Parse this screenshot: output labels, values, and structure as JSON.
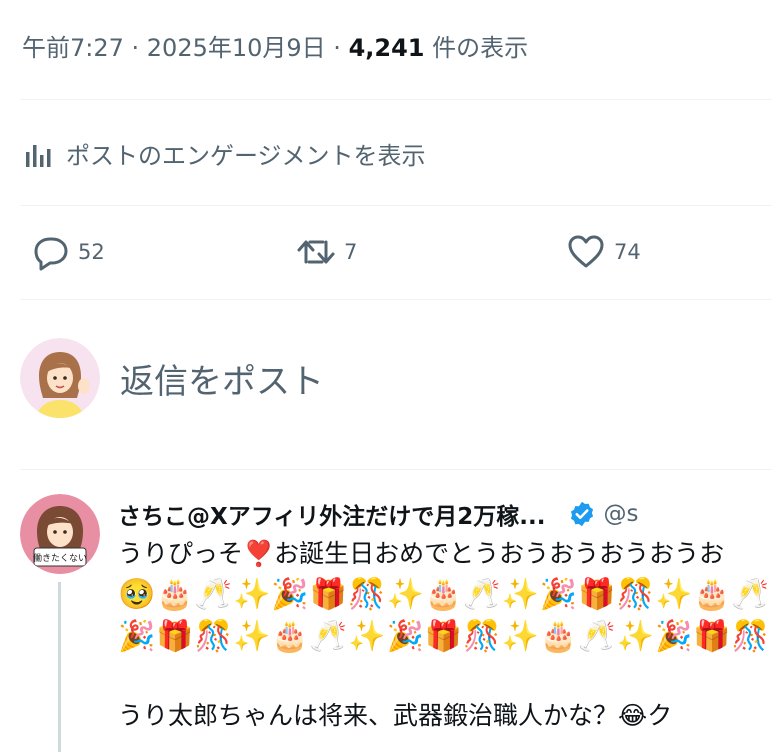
{
  "meta": {
    "time": "午前7:27 · 2025年10月9日 · ",
    "views_count": "4,241",
    "views_label": " 件の表示"
  },
  "engagement_link": "ポストのエンゲージメントを表示",
  "actions": {
    "replies": "52",
    "reposts": "7",
    "likes": "74"
  },
  "compose": {
    "placeholder": "返信をポスト"
  },
  "reply": {
    "author_name": "さちこ@Xアフィリ外注だけで月2万稼...",
    "handle": "@s",
    "line1": "うりぴっそ❣️お誕生日おめでとうおうおうおうおうお",
    "emoji_line1": "🥹🎂🥂✨🎉🎁🎊✨🎂🥂✨🎉🎁🎊✨🎂🥂",
    "emoji_line2": "🎉🎁🎊✨🎂🥂✨🎉🎁🎊✨🎂🥂✨🎉🎁🎊",
    "line2": "うり太郎ちゃんは将来、武器鍛治職人かな？😂ク",
    "avatar_sign": "働きたくない"
  },
  "colors": {
    "text_primary": "#0f1419",
    "text_secondary": "#536471",
    "divider": "#eff3f4",
    "verified_blue": "#1d9bf0"
  }
}
